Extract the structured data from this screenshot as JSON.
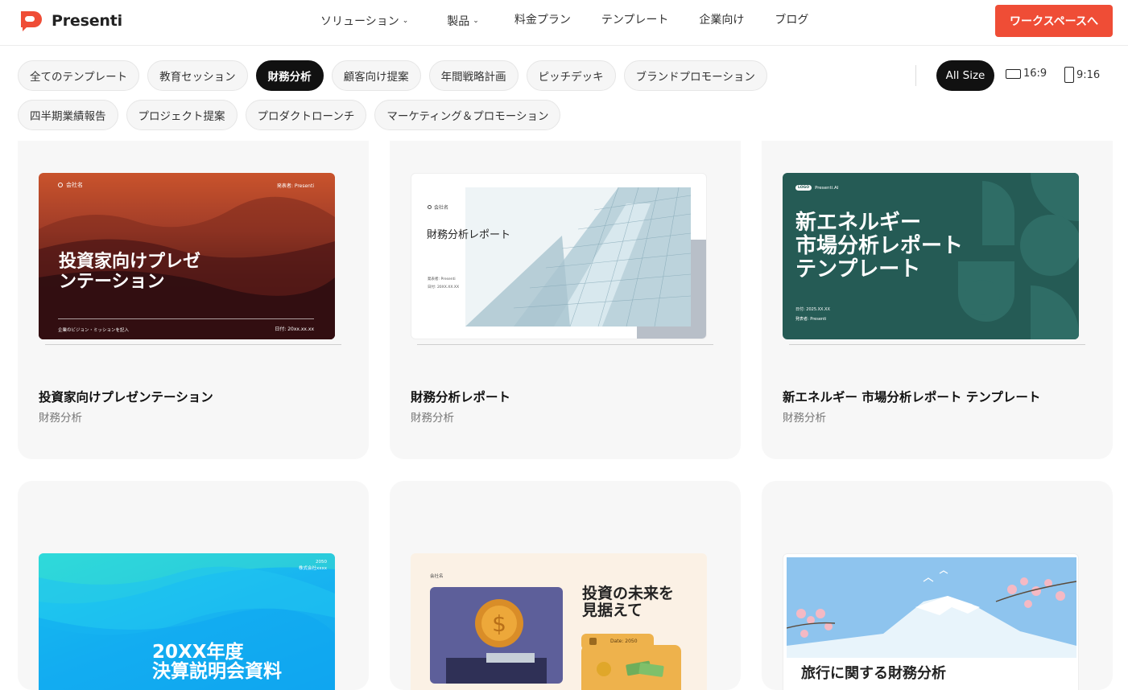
{
  "header": {
    "brand": "Presenti",
    "nav": [
      {
        "label": "ソリューション",
        "dropdown": true
      },
      {
        "label": "製品",
        "dropdown": true
      },
      {
        "label": "料金プラン",
        "dropdown": false
      },
      {
        "label": "テンプレート",
        "dropdown": false
      },
      {
        "label": "企業向け",
        "dropdown": false
      },
      {
        "label": "ブログ",
        "dropdown": false
      }
    ],
    "cta": "ワークスペースへ",
    "accent": "#ef4d36"
  },
  "filters": {
    "row1": [
      "全てのテンプレート",
      "教育セッション",
      "財務分析",
      "顧客向け提案",
      "年間戦略計画",
      "ピッチデッキ",
      "ブランドプロモーション"
    ],
    "row2": [
      "四半期業績報告",
      "プロジェクト提案",
      "プロダクトローンチ",
      "マーケティング＆プロモーション"
    ],
    "active": "財務分析",
    "sizes": {
      "all": "All Size",
      "wide": "16:9",
      "tall": "9:16",
      "active": "All Size"
    }
  },
  "cards": [
    {
      "title": "投資家向けプレゼンテーション",
      "category": "財務分析",
      "thumb": {
        "company": "会社名",
        "presenter": "発表者: Presenti",
        "heading1": "投資家向けプレゼ",
        "heading2": "ンテーション",
        "footer": "企業のビジョン・ミッションを記入",
        "date": "日付: 20xx.xx.xx"
      }
    },
    {
      "title": "財務分析レポート",
      "category": "財務分析",
      "thumb": {
        "company": "会社名",
        "heading": "財務分析レポート",
        "presenter": "発表者: Presenti",
        "date": "日付: 20XX.XX.XX"
      }
    },
    {
      "title": "新エネルギー 市場分析レポート テンプレート",
      "category": "財務分析",
      "thumb": {
        "logo": "LOGO",
        "brand": "Presenti.AI",
        "line1": "新エネルギー",
        "line2": "市場分析レポート",
        "line3": "テンプレート",
        "date": "日付: 2025.XX.XX",
        "presenter": "発表者: Presenti"
      }
    },
    {
      "title": "",
      "category": "",
      "thumb": {
        "year": "2050",
        "company": "株式会社xxxx",
        "line1": "20XX年度",
        "line2": "決算説明会資料"
      }
    },
    {
      "title": "",
      "category": "",
      "thumb": {
        "company": "会社名",
        "line1": "投資の未来を",
        "line2": "見据えて",
        "date": "Date: 2050"
      }
    },
    {
      "title": "",
      "category": "",
      "thumb": {
        "heading": "旅行に関する財務分析"
      }
    }
  ]
}
